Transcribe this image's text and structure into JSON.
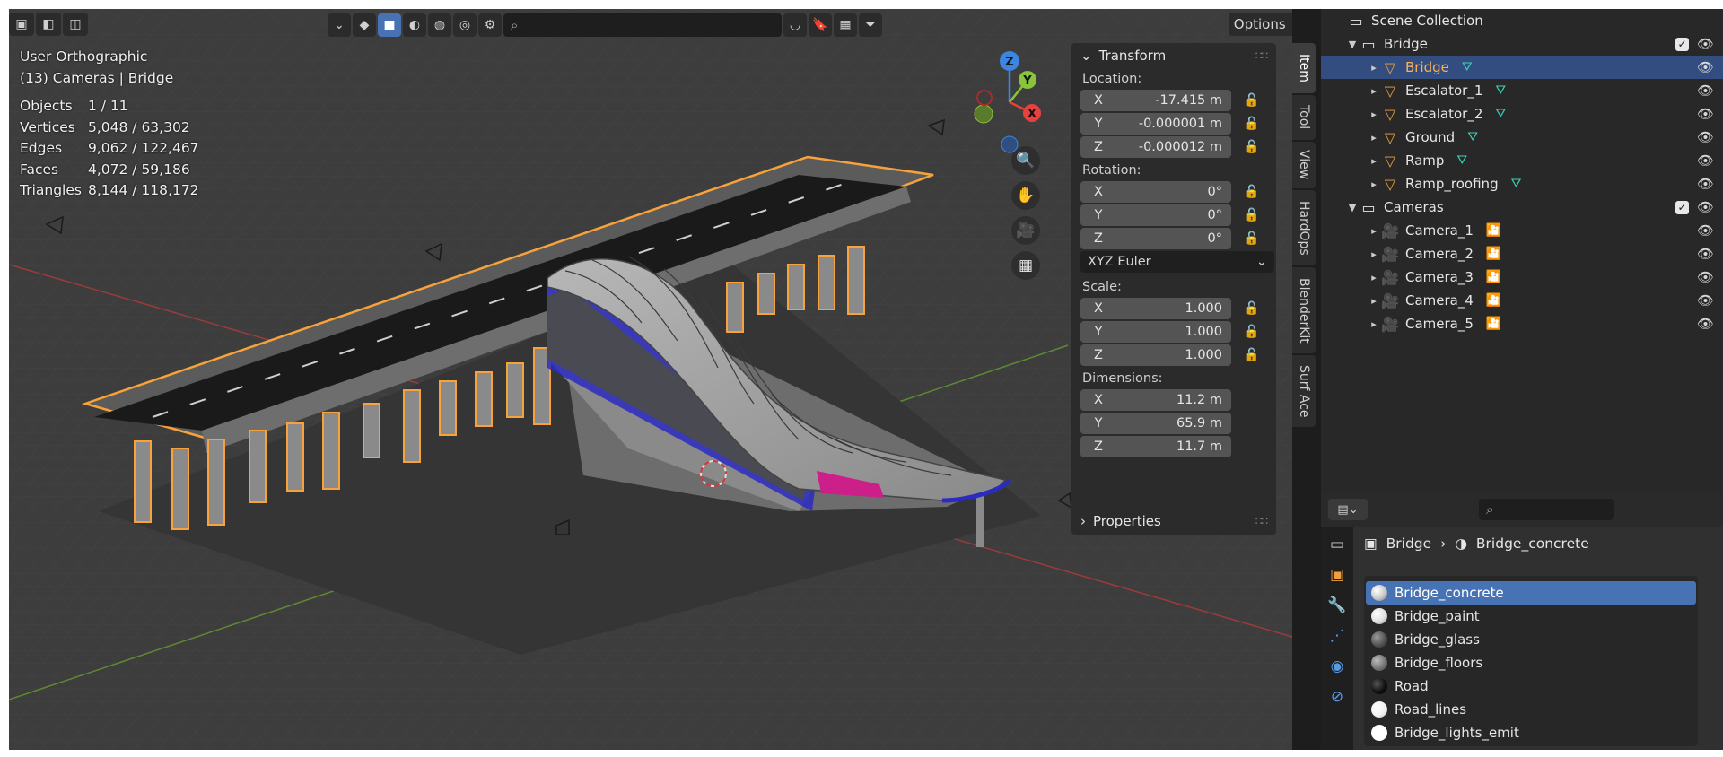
{
  "viewport": {
    "view_name": "User Orthographic",
    "context": "(13) Cameras | Bridge",
    "stats": [
      {
        "label": "Objects",
        "value": "1 / 11"
      },
      {
        "label": "Vertices",
        "value": "5,048 / 63,302"
      },
      {
        "label": "Edges",
        "value": "9,062 / 122,467"
      },
      {
        "label": "Faces",
        "value": "4,072 / 59,186"
      },
      {
        "label": "Triangles",
        "value": "8,144 / 118,172"
      }
    ],
    "options_label": "Options",
    "gizmo_axes": {
      "z": "Z",
      "y": "Y",
      "x": "X"
    }
  },
  "npanel": {
    "transform_title": "Transform",
    "location_label": "Location:",
    "location": [
      {
        "axis": "X",
        "value": "-17.415 m"
      },
      {
        "axis": "Y",
        "value": "-0.000001 m"
      },
      {
        "axis": "Z",
        "value": "-0.000012 m"
      }
    ],
    "rotation_label": "Rotation:",
    "rotation": [
      {
        "axis": "X",
        "value": "0°"
      },
      {
        "axis": "Y",
        "value": "0°"
      },
      {
        "axis": "Z",
        "value": "0°"
      }
    ],
    "rotation_mode": "XYZ Euler",
    "scale_label": "Scale:",
    "scale": [
      {
        "axis": "X",
        "value": "1.000"
      },
      {
        "axis": "Y",
        "value": "1.000"
      },
      {
        "axis": "Z",
        "value": "1.000"
      }
    ],
    "dimensions_label": "Dimensions:",
    "dimensions": [
      {
        "axis": "X",
        "value": "11.2 m"
      },
      {
        "axis": "Y",
        "value": "65.9 m"
      },
      {
        "axis": "Z",
        "value": "11.7 m"
      }
    ],
    "properties_title": "Properties"
  },
  "side_tabs": [
    "Item",
    "Tool",
    "View",
    "HardOps",
    "BlenderKit",
    "Surf Ace"
  ],
  "outliner": {
    "rows": [
      {
        "name": "Scene Collection",
        "type": "scene",
        "level": 0
      },
      {
        "name": "Bridge",
        "type": "collection",
        "level": 1,
        "expanded": true,
        "checked": true
      },
      {
        "name": "Bridge",
        "type": "mesh",
        "level": 2,
        "selected": true
      },
      {
        "name": "Escalator_1",
        "type": "mesh",
        "level": 2
      },
      {
        "name": "Escalator_2",
        "type": "mesh",
        "level": 2
      },
      {
        "name": "Ground",
        "type": "mesh",
        "level": 2
      },
      {
        "name": "Ramp",
        "type": "mesh",
        "level": 2
      },
      {
        "name": "Ramp_roofing",
        "type": "mesh",
        "level": 2
      },
      {
        "name": "Cameras",
        "type": "collection",
        "level": 1,
        "expanded": true,
        "checked": true
      },
      {
        "name": "Camera_1",
        "type": "camera",
        "level": 2
      },
      {
        "name": "Camera_2",
        "type": "camera",
        "level": 2
      },
      {
        "name": "Camera_3",
        "type": "camera",
        "level": 2
      },
      {
        "name": "Camera_4",
        "type": "camera",
        "level": 2
      },
      {
        "name": "Camera_5",
        "type": "camera",
        "level": 2
      }
    ]
  },
  "properties": {
    "breadcrumb_object": "Bridge",
    "breadcrumb_material": "Bridge_concrete",
    "materials": [
      {
        "name": "Bridge_concrete",
        "color": "#c9c9c9",
        "selected": true
      },
      {
        "name": "Bridge_paint",
        "color": "#e0e0e0"
      },
      {
        "name": "Bridge_glass",
        "color": "#555555"
      },
      {
        "name": "Bridge_floors",
        "color": "#777777"
      },
      {
        "name": "Road",
        "color": "#111111"
      },
      {
        "name": "Road_lines",
        "color": "#f2f2f2"
      },
      {
        "name": "Bridge_lights_emit",
        "color": "#ffffff"
      }
    ]
  },
  "colors": {
    "accent": "#4772b3",
    "selection_outline": "#f7a23a",
    "outliner_selected": "#334d80",
    "x_axis": "#e8403c",
    "y_axis": "#8ac43a",
    "z_axis": "#3a86e0"
  }
}
